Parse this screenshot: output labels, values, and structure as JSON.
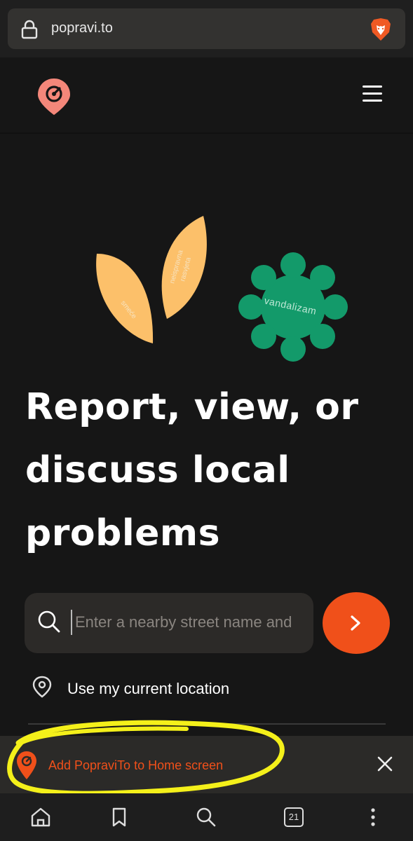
{
  "browser": {
    "url": "popravi.to",
    "tab_count": "21"
  },
  "illustration": {
    "leaf1_label": "smeće",
    "leaf2_label_line1": "neispravna",
    "leaf2_label_line2": "rasvjeta",
    "flower_label": "vandalizam",
    "colors": {
      "leaf": "#fcc06a",
      "flower": "#139a6a",
      "accent": "#f0501a"
    }
  },
  "hero": {
    "title_line1": "Report, view, or",
    "title_line2": "discuss local",
    "title_line3": "problems"
  },
  "search": {
    "placeholder": "Enter a nearby street name and"
  },
  "location": {
    "label": "Use my current location"
  },
  "a2hs": {
    "label": "Add PopraviTo to Home screen"
  },
  "toolbar": {
    "icons": [
      "home-icon",
      "bookmark-icon",
      "search-icon",
      "tabs-icon",
      "more-icon"
    ]
  }
}
